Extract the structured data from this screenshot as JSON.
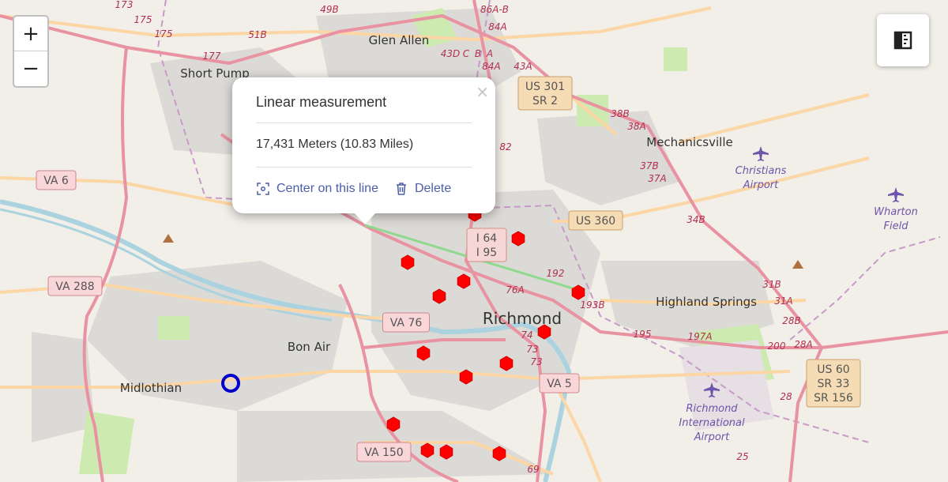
{
  "map": {
    "places": {
      "glen_allen": "Glen Allen",
      "short_pump": "Short Pump",
      "mechanicsville": "Mechanicsville",
      "highland_springs": "Highland Springs",
      "richmond": "Richmond",
      "bon_air": "Bon Air",
      "midlothian": "Midlothian",
      "christians_airport": [
        "Christians",
        "Airport"
      ],
      "wharton_field": [
        "Wharton",
        "Field"
      ],
      "richmond_airport": [
        "Richmond",
        "International",
        "Airport"
      ]
    },
    "route_shields": {
      "va6": "VA 6",
      "va288": "VA 288",
      "va76": "VA 76",
      "va150": "VA 150",
      "va5": "VA 5",
      "us360": "US 360",
      "us301": [
        "US 301",
        "SR 2"
      ],
      "i64": [
        "I 64",
        "I 95"
      ],
      "us60": [
        "US 60",
        "SR 33",
        "SR 156"
      ]
    },
    "exit_labels": [
      "173",
      "175",
      "175",
      "177",
      "49B",
      "51B",
      "86A-B",
      "84A",
      "43D",
      "C",
      "B",
      "A",
      "84A",
      "43A",
      "38B",
      "38A",
      "37B",
      "37A",
      "82",
      "34B",
      "192",
      "76A",
      "193B",
      "195",
      "197A",
      "74",
      "73",
      "73",
      "200",
      "28A",
      "31B",
      "31A",
      "28B",
      "28",
      "25",
      "69"
    ]
  },
  "zoom": {
    "in": "+",
    "out": "−"
  },
  "measure_tool": {
    "icon": "ruler-icon"
  },
  "popup": {
    "title": "Linear measurement",
    "distance": "17,431 Meters (10.83 Miles)",
    "center_label": "Center on this line",
    "delete_label": "Delete",
    "close": "×"
  },
  "colors": {
    "motorway": "#e892a2",
    "primary": "#fcd6a4",
    "marker": "#ff0000",
    "start_marker": "#0000cc",
    "line": "#8fd98f",
    "link": "#4b5ea8"
  }
}
